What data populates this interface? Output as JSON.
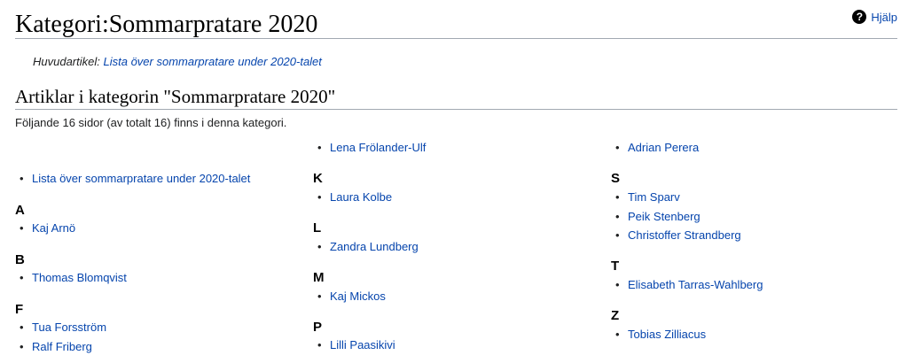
{
  "title": "Kategori:Sommarpratare 2020",
  "help_label": "Hjälp",
  "hatnote": {
    "prefix": "Huvudartikel:",
    "link": "Lista över sommarpratare under 2020-talet"
  },
  "section_heading": "Artiklar i kategorin \"Sommarpratare 2020\"",
  "intro": "Följande 16 sidor (av totalt 16) finns i denna kategori.",
  "columns": [
    [
      {
        "type": "item",
        "text": "Lista över sommarpratare under 2020-talet"
      },
      {
        "type": "letter",
        "text": "A"
      },
      {
        "type": "item",
        "text": "Kaj Arnö"
      },
      {
        "type": "letter",
        "text": "B"
      },
      {
        "type": "item",
        "text": "Thomas Blomqvist"
      },
      {
        "type": "letter",
        "text": "F"
      },
      {
        "type": "item",
        "text": "Tua Forsström"
      },
      {
        "type": "item",
        "text": "Ralf Friberg"
      }
    ],
    [
      {
        "type": "item",
        "text": "Lena Frölander-Ulf"
      },
      {
        "type": "letter",
        "text": "K"
      },
      {
        "type": "item",
        "text": "Laura Kolbe"
      },
      {
        "type": "letter",
        "text": "L"
      },
      {
        "type": "item",
        "text": "Zandra Lundberg"
      },
      {
        "type": "letter",
        "text": "M"
      },
      {
        "type": "item",
        "text": "Kaj Mickos"
      },
      {
        "type": "letter",
        "text": "P"
      },
      {
        "type": "item",
        "text": "Lilli Paasikivi"
      }
    ],
    [
      {
        "type": "item",
        "text": "Adrian Perera"
      },
      {
        "type": "letter",
        "text": "S"
      },
      {
        "type": "item",
        "text": "Tim Sparv"
      },
      {
        "type": "item",
        "text": "Peik Stenberg"
      },
      {
        "type": "item",
        "text": "Christoffer Strandberg"
      },
      {
        "type": "letter",
        "text": "T"
      },
      {
        "type": "item",
        "text": "Elisabeth Tarras-Wahlberg"
      },
      {
        "type": "letter",
        "text": "Z"
      },
      {
        "type": "item",
        "text": "Tobias Zilliacus"
      }
    ]
  ]
}
